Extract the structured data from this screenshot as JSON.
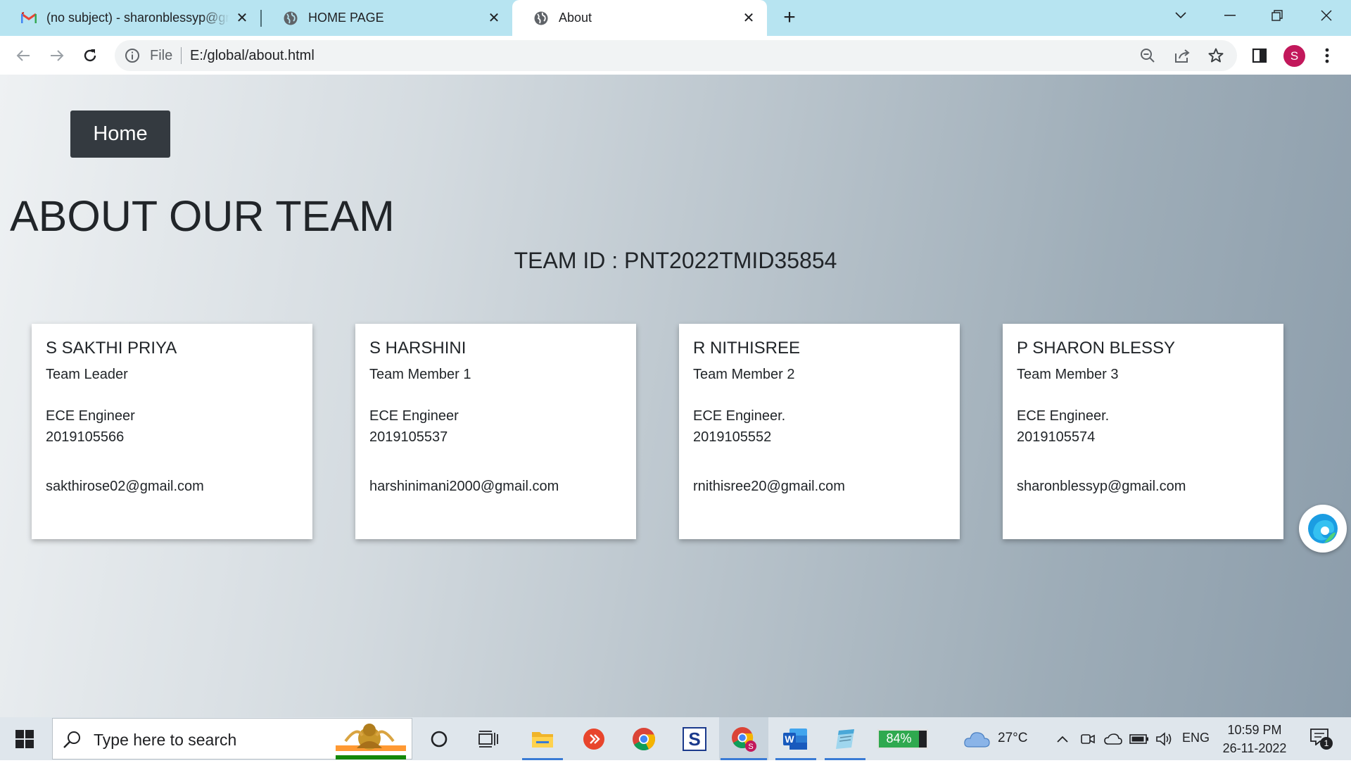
{
  "browser": {
    "tabs": [
      {
        "title": "(no subject) - sharonblessyp@gmail.com",
        "icon": "gmail-icon"
      },
      {
        "title": "HOME PAGE",
        "icon": "globe-icon"
      },
      {
        "title": "About",
        "icon": "globe-icon",
        "active": true
      }
    ],
    "new_tab": "+",
    "address": {
      "scheme_label": "File",
      "url": "E:/global/about.html"
    },
    "profile_initial": "S"
  },
  "page": {
    "home_button": "Home",
    "heading": "ABOUT OUR TEAM",
    "team_id": "TEAM ID : PNT2022TMID35854",
    "members": [
      {
        "name": "S SAKTHI PRIYA",
        "role": "Team Leader",
        "degree": "ECE Engineer",
        "reg_no": "2019105566",
        "email": "sakthirose02@gmail.com"
      },
      {
        "name": "S HARSHINI",
        "role": "Team Member 1",
        "degree": "ECE Engineer",
        "reg_no": "2019105537",
        "email": "harshinimani2000@gmail.com"
      },
      {
        "name": "R NITHISREE",
        "role": "Team Member 2",
        "degree": "ECE Engineer.",
        "reg_no": "2019105552",
        "email": "rnithisree20@gmail.com"
      },
      {
        "name": "P SHARON BLESSY",
        "role": "Team Member 3",
        "degree": "ECE Engineer.",
        "reg_no": "2019105574",
        "email": "sharonblessyp@gmail.com"
      }
    ]
  },
  "taskbar": {
    "search_placeholder": "Type here to search",
    "battery_widget": "84%",
    "weather": "27°C",
    "language": "ENG",
    "time": "10:59 PM",
    "date": "26-11-2022",
    "notification_count": "1"
  },
  "colors": {
    "tab_bar": "#b7e4f1",
    "home_button": "#343a40",
    "profile_avatar": "#c2185b",
    "taskbar": "#dfe6ec"
  }
}
